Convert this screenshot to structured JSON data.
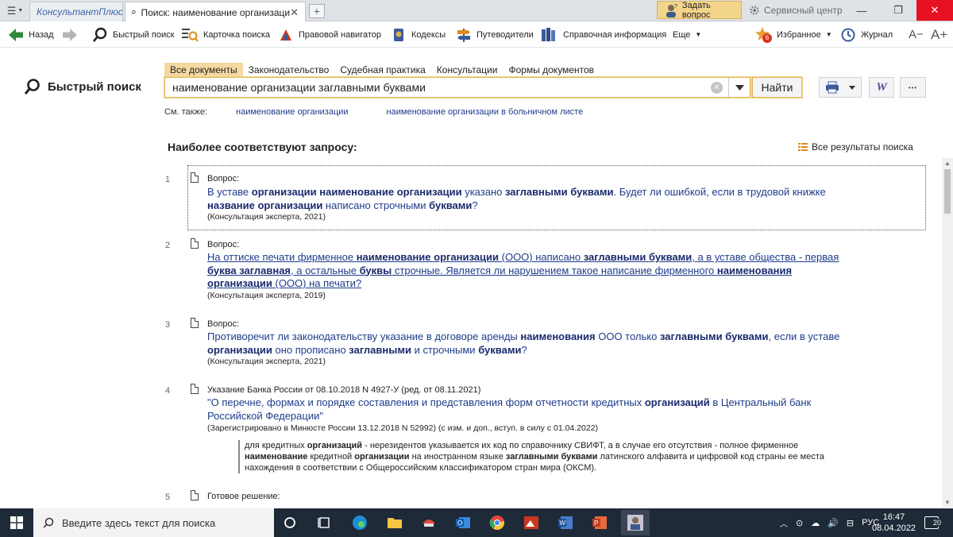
{
  "titlebar": {
    "home_tab": "КонсультантПлюс",
    "active_tab": "Поиск: наименование организаци",
    "active_tab_close": "✕",
    "add_tab": "+",
    "ask_button": "Задать вопрос",
    "service_center": "Сервисный центр",
    "window_controls": {
      "minimize": "—",
      "maximize": "❐",
      "close": "✕"
    }
  },
  "toolbar": {
    "back": "Назад",
    "quick_search": "Быстрый поиск",
    "search_card": "Карточка поиска",
    "legal_navigator": "Правовой навигатор",
    "codes": "Кодексы",
    "guides": "Путеводители",
    "reference": "Справочная информация",
    "more": "Еще",
    "favorites": "Избранное",
    "favorites_badge": "6",
    "journal": "Журнал",
    "font_smaller": "A−",
    "font_larger": "A+"
  },
  "search": {
    "page_title": "Быстрый поиск",
    "tabs": [
      "Все документы",
      "Законодательство",
      "Судебная практика",
      "Консультации",
      "Формы документов"
    ],
    "query": "наименование организации заглавными буквами",
    "find_button": "Найти",
    "word_button": "W",
    "more_button": "•••",
    "see_also_label": "См. также:",
    "see_also_links": [
      "наименование организации",
      "наименование организации в больничном листе"
    ]
  },
  "results": {
    "heading": "Наиболее соответствуют запросу:",
    "all_results_link": "Все результаты поиска",
    "items": [
      {
        "num": "1",
        "kind": "Вопрос:",
        "lines": [
          [
            [
              "В уставе ",
              false
            ],
            [
              "организации наименование организации",
              true
            ],
            [
              " указано ",
              false
            ],
            [
              "заглавными буквами",
              true
            ],
            [
              ". Будет ли ошибкой, если в трудовой книжке",
              false
            ]
          ],
          [
            [
              "название организации",
              true
            ],
            [
              " написано строчными ",
              false
            ],
            [
              "буквами",
              true
            ],
            [
              "?",
              false
            ]
          ]
        ],
        "source": "(Консультация эксперта, 2021)"
      },
      {
        "num": "2",
        "kind": "Вопрос:",
        "lines": [
          [
            [
              "На оттиске печати фирменное ",
              false
            ],
            [
              "наименование организации",
              true
            ],
            [
              " (ООО) написано ",
              false
            ],
            [
              "заглавными буквами",
              true
            ],
            [
              ", а в уставе общества - первая",
              false
            ]
          ],
          [
            [
              "буква заглавная",
              true
            ],
            [
              ", а остальные ",
              false
            ],
            [
              "буквы",
              true
            ],
            [
              " строчные. Является ли нарушением такое написание фирменного ",
              false
            ],
            [
              "наименования",
              true
            ]
          ],
          [
            [
              "организации",
              true
            ],
            [
              " (ООО) на печати?",
              false
            ]
          ]
        ],
        "source": "(Консультация эксперта, 2019)"
      },
      {
        "num": "3",
        "kind": "Вопрос:",
        "lines": [
          [
            [
              "Противоречит ли законодательству указание в договоре аренды ",
              false
            ],
            [
              "наименования",
              true
            ],
            [
              " ООО только ",
              false
            ],
            [
              "заглавными буквами",
              true
            ],
            [
              ", если в уставе",
              false
            ]
          ],
          [
            [
              "организации",
              true
            ],
            [
              " оно прописано ",
              false
            ],
            [
              "заглавными",
              true
            ],
            [
              " и строчными ",
              false
            ],
            [
              "буквами",
              true
            ],
            [
              "?",
              false
            ]
          ]
        ],
        "source": "(Консультация эксперта, 2021)"
      },
      {
        "num": "4",
        "kind": "Указание Банка России от 08.10.2018 N 4927-У (ред. от 08.11.2021)",
        "lines": [
          [
            [
              "\"О перечне, формах и порядке составления и представления форм отчетности кредитных ",
              false
            ],
            [
              "организаций",
              true
            ],
            [
              " в Центральный банк",
              false
            ]
          ],
          [
            [
              "Российской Федерации\"",
              false
            ]
          ]
        ],
        "source": "(Зарегистрировано в Минюсте России 13.12.2018 N 52992) (с изм. и доп., вступ. в силу с 01.04.2022)",
        "snippet": [
          [
            [
              "для кредитных ",
              false
            ],
            [
              "организаций",
              true
            ],
            [
              " - нерезидентов указывается их код по справочнику СВИФТ, а в случае его отсутствия - полное фирменное",
              false
            ]
          ],
          [
            [
              "наименование",
              true
            ],
            [
              " кредитной ",
              false
            ],
            [
              "организации",
              true
            ],
            [
              " на иностранном языке ",
              false
            ],
            [
              "заглавными буквами",
              true
            ],
            [
              " латинского алфавита и цифровой код страны ее места",
              false
            ]
          ],
          [
            [
              "нахождения в соответствии с Общероссийским классификатором стран мира (ОКСМ).",
              false
            ]
          ]
        ]
      },
      {
        "num": "5",
        "kind": "Готовое решение:",
        "lines": [],
        "source": ""
      }
    ]
  },
  "taskbar": {
    "search_placeholder": "Введите здесь текст для поиска",
    "language": "РУС",
    "time": "16:47",
    "date": "08.04.2022",
    "notifications": "20"
  },
  "colors": {
    "accent": "#f2d48b",
    "link": "#1e3c8c",
    "close": "#e81123"
  }
}
